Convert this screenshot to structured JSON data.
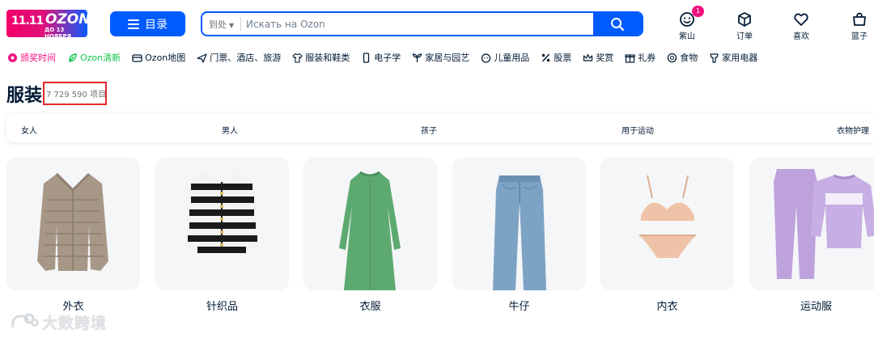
{
  "header": {
    "logo": {
      "line1": "11.11",
      "line2": "OZON",
      "line3": "ДО 13 НОЯБРЯ"
    },
    "catalog_label": "目录",
    "search": {
      "scope": "到处",
      "placeholder": "Искать на Ozon"
    },
    "items": [
      {
        "label": "紫山",
        "icon": "face-icon",
        "badge": "1"
      },
      {
        "label": "订单",
        "icon": "box-icon"
      },
      {
        "label": "喜欢",
        "icon": "heart-icon"
      },
      {
        "label": "篮子",
        "icon": "basket-icon"
      }
    ]
  },
  "nav": [
    {
      "label": "颁奖时间",
      "icon": "gift-icon",
      "style": "pink"
    },
    {
      "label": "Ozon清新",
      "icon": "leaf-icon",
      "style": "teal"
    },
    {
      "label": "Ozon地图",
      "icon": "card-icon"
    },
    {
      "label": "门票、酒店、旅游",
      "icon": "plane-icon"
    },
    {
      "label": "服装和鞋类",
      "icon": "shirt-icon"
    },
    {
      "label": "电子学",
      "icon": "phone-icon"
    },
    {
      "label": "家居与园艺",
      "icon": "plant-icon"
    },
    {
      "label": "儿童用品",
      "icon": "baby-icon"
    },
    {
      "label": "股票",
      "icon": "percent-icon"
    },
    {
      "label": "奖赏",
      "icon": "crown-icon"
    },
    {
      "label": "礼券",
      "icon": "voucher-icon"
    },
    {
      "label": "食物",
      "icon": "food-icon"
    },
    {
      "label": "家用电器",
      "icon": "appliance-icon"
    }
  ],
  "page": {
    "title": "服装",
    "count": "7 729 590 项目"
  },
  "subcategories": [
    "女人",
    "男人",
    "孩子",
    "用于运动",
    "衣物护理"
  ],
  "cards": [
    {
      "label": "外衣",
      "icon": "jacket-icon"
    },
    {
      "label": "针织品",
      "icon": "cardigan-icon"
    },
    {
      "label": "衣服",
      "icon": "dress-icon"
    },
    {
      "label": "牛仔",
      "icon": "jeans-icon"
    },
    {
      "label": "内衣",
      "icon": "underwear-icon"
    },
    {
      "label": "运动服",
      "icon": "tracksuit-icon"
    }
  ],
  "watermark": "大数跨境",
  "colors": {
    "primary": "#005bff",
    "pink": "#f1117e",
    "teal": "#10c44c",
    "highlight": "#e4282b",
    "text": "#001a34"
  }
}
